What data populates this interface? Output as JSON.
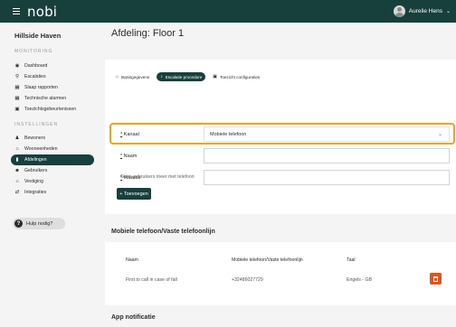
{
  "topbar": {
    "brand": "nobi",
    "user_name": "Aurelie Hens",
    "user_chevron": "⌄"
  },
  "sidebar": {
    "site_name": "Hillside Haven",
    "monitoring_label": "MONITORING",
    "monitoring_items": [
      {
        "icon": "dashboard-icon",
        "glyph": "◉",
        "label": "Dashboard"
      },
      {
        "icon": "escalation-pin-icon",
        "glyph": "⚲",
        "label": "Escalaties"
      },
      {
        "icon": "sleep-report-icon",
        "glyph": "▦",
        "label": "Slaap rapporten"
      },
      {
        "icon": "technical-alarm-icon",
        "glyph": "▦",
        "label": "Technische alarmen"
      },
      {
        "icon": "tv-assessment-icon",
        "glyph": "▣",
        "label": "Toezichtsgebeurtenissen"
      }
    ],
    "settings_label": "INSTELLINGEN",
    "settings_items": [
      {
        "icon": "residents-icon",
        "glyph": "♟",
        "label": "Bewoners"
      },
      {
        "icon": "living-unit-icon",
        "glyph": "⌂",
        "label": "Wooneenheden"
      },
      {
        "icon": "department-icon",
        "glyph": "▮",
        "label": "Afdelingen"
      },
      {
        "icon": "users-icon",
        "glyph": "☻",
        "label": "Gebruikers"
      },
      {
        "icon": "location-icon",
        "glyph": "⌂",
        "label": "Vestiging"
      },
      {
        "icon": "integrations-icon",
        "glyph": "⇄",
        "label": "Integraties"
      }
    ],
    "active_item": "Afdelingen",
    "help_label": "Hulp nodig?"
  },
  "main": {
    "title": "Afdeling: Floor 1",
    "tabs": [
      {
        "icon": "home-icon",
        "glyph": "⌂",
        "label": "Basisgegevens"
      },
      {
        "icon": "bell-icon",
        "glyph": "♪",
        "label": "Escalatie procedure"
      },
      {
        "icon": "monitor-config-icon",
        "glyph": "▣",
        "label": "Toezicht configuraties"
      }
    ],
    "active_tab": "Escalatie procedure",
    "form": {
      "kanaal_label": "Kanaal",
      "kanaal_value": "Mobiele telefoon",
      "naam_label": "Naam",
      "naam_value": "",
      "waarde_label": "Waarde",
      "waarde_value": "",
      "required_marker": "*"
    },
    "no_more_users_text": "Geen gebruikers meer met telefoon",
    "add_button_label": "+ Toevoegen"
  },
  "phone_section": {
    "title": "Mobiele telefoon/Vaste telefoonlijn",
    "columns": [
      "Naam",
      "Mobiele telefoon/Vaste telefoonlijn",
      "Taal"
    ],
    "rows": [
      {
        "naam": "First to call in case of fall",
        "telefoon": "+32486027729",
        "taal": "Engels - GB"
      }
    ]
  },
  "app_section": {
    "title": "App notificatie"
  },
  "colors": {
    "brand_dark": "#17403d",
    "highlight": "#f1a21a",
    "delete": "#e0531c"
  }
}
